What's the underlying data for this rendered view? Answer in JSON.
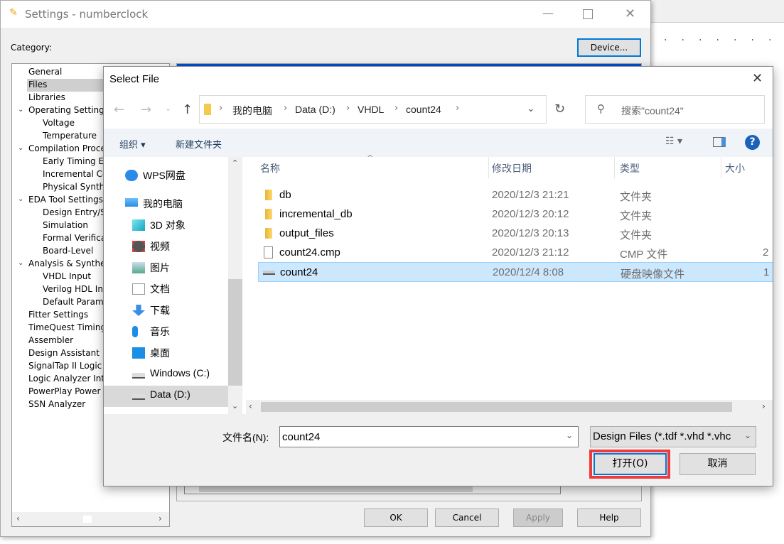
{
  "settings": {
    "title": "Settings - numberclock",
    "category_label": "Category:",
    "device_button": "Device...",
    "tree": [
      {
        "label": "General",
        "level": 0
      },
      {
        "label": "Files",
        "level": 0,
        "selected": true
      },
      {
        "label": "Libraries",
        "level": 0
      },
      {
        "label": "Operating Settings",
        "level": 0,
        "expanded": true
      },
      {
        "label": "Voltage",
        "level": 1
      },
      {
        "label": "Temperature",
        "level": 1
      },
      {
        "label": "Compilation Proces",
        "level": 0,
        "expanded": true
      },
      {
        "label": "Early Timing Es",
        "level": 1
      },
      {
        "label": "Incremental Co",
        "level": 1
      },
      {
        "label": "Physical Synthe",
        "level": 1
      },
      {
        "label": "EDA Tool Settings",
        "level": 0,
        "expanded": true
      },
      {
        "label": "Design Entry/Sy",
        "level": 1
      },
      {
        "label": "Simulation",
        "level": 1
      },
      {
        "label": "Formal Verifica",
        "level": 1
      },
      {
        "label": "Board-Level",
        "level": 1
      },
      {
        "label": "Analysis & Synthes",
        "level": 0,
        "expanded": true
      },
      {
        "label": "VHDL Input",
        "level": 1
      },
      {
        "label": "Verilog HDL Inp",
        "level": 1
      },
      {
        "label": "Default Parame",
        "level": 1
      },
      {
        "label": "Fitter Settings",
        "level": 0
      },
      {
        "label": "TimeQuest Timing",
        "level": 0
      },
      {
        "label": "Assembler",
        "level": 0
      },
      {
        "label": "Design Assistant",
        "level": 0
      },
      {
        "label": "SignalTap II Logic",
        "level": 0
      },
      {
        "label": "Logic Analyzer Inte",
        "level": 0
      },
      {
        "label": "PowerPlay Power A",
        "level": 0
      },
      {
        "label": "SSN Analyzer",
        "level": 0
      }
    ],
    "buttons": {
      "ok": "OK",
      "cancel": "Cancel",
      "apply": "Apply",
      "help": "Help"
    }
  },
  "dialog": {
    "title": "Select File",
    "breadcrumb": [
      "我的电脑",
      "Data (D:)",
      "VHDL",
      "count24"
    ],
    "search_placeholder": "搜索\"count24\"",
    "toolbar": {
      "organize": "组织",
      "new_folder": "新建文件夹"
    },
    "nav": [
      {
        "label": "WPS网盘",
        "icon": "cloud-icon"
      },
      {
        "label": "我的电脑",
        "icon": "computer-icon"
      },
      {
        "label": "3D 对象",
        "icon": "cube-icon"
      },
      {
        "label": "视频",
        "icon": "video-icon"
      },
      {
        "label": "图片",
        "icon": "picture-icon"
      },
      {
        "label": "文档",
        "icon": "document-icon"
      },
      {
        "label": "下载",
        "icon": "download-icon"
      },
      {
        "label": "音乐",
        "icon": "music-icon"
      },
      {
        "label": "桌面",
        "icon": "desktop-icon"
      },
      {
        "label": "Windows (C:)",
        "icon": "drive-icon"
      },
      {
        "label": "Data (D:)",
        "icon": "drive-icon",
        "selected": true
      }
    ],
    "columns": {
      "name": "名称",
      "date": "修改日期",
      "type": "类型",
      "size": "大小"
    },
    "files": [
      {
        "name": "db",
        "date": "2020/12/3 21:21",
        "type": "文件夹",
        "size": "",
        "kind": "folder"
      },
      {
        "name": "incremental_db",
        "date": "2020/12/3 20:12",
        "type": "文件夹",
        "size": "",
        "kind": "folder"
      },
      {
        "name": "output_files",
        "date": "2020/12/3 20:13",
        "type": "文件夹",
        "size": "",
        "kind": "folder"
      },
      {
        "name": "count24.cmp",
        "date": "2020/12/3 21:12",
        "type": "CMP 文件",
        "size": "2",
        "kind": "file"
      },
      {
        "name": "count24",
        "date": "2020/12/4 8:08",
        "type": "硬盘映像文件",
        "size": "1",
        "kind": "disk",
        "selected": true
      }
    ],
    "filename_label": "文件名(N):",
    "filename_value": "count24",
    "filter": "Design Files (*.tdf *.vhd *.vhc",
    "open_button": "打开(O)",
    "cancel_button": "取消",
    "highlight_color": "#f03a3a"
  }
}
